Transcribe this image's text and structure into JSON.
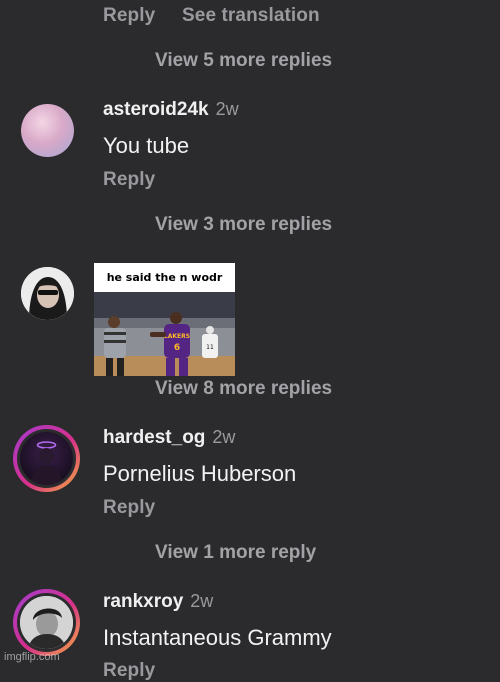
{
  "top": {
    "reply_label": "Reply",
    "translation_label": "See translation",
    "view_more": "View 5 more replies"
  },
  "comments": [
    {
      "username": "asteroid24k",
      "time": "2w",
      "text": "You tube",
      "reply_label": "Reply",
      "view_more": "View 3 more replies"
    },
    {
      "meme_caption": "he said the n wodr",
      "view_more": "View 8 more replies"
    },
    {
      "username": "hardest_og",
      "time": "2w",
      "text": "Pornelius Huberson",
      "reply_label": "Reply",
      "view_more": "View 1 more reply"
    },
    {
      "username": "rankxroy",
      "time": "2w",
      "text": "Instantaneous Grammy",
      "reply_label": "Reply"
    }
  ],
  "watermark": "imgflip.com",
  "colors": {
    "background": "#2b2b2e",
    "muted_text": "#9a9a9e",
    "primary_text": "#f2f2f2",
    "story_ring_start": "#a33bd1",
    "story_ring_end": "#f5b13a"
  }
}
